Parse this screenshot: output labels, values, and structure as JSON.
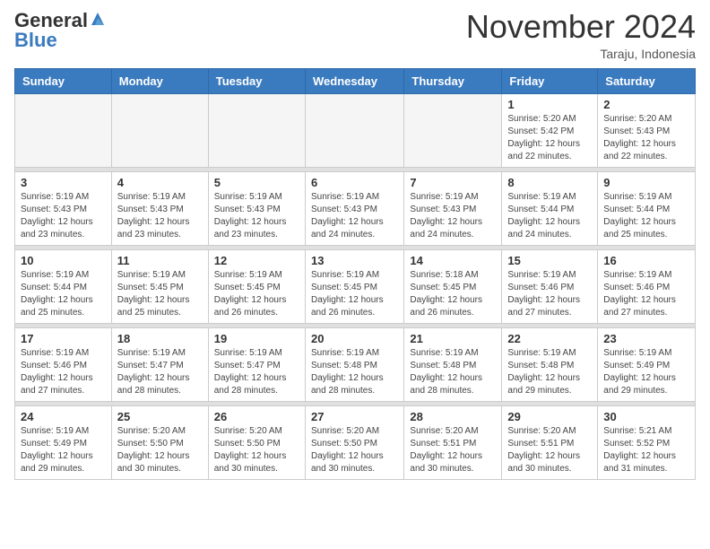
{
  "logo": {
    "general": "General",
    "blue": "Blue"
  },
  "header": {
    "month": "November 2024",
    "location": "Taraju, Indonesia"
  },
  "weekdays": [
    "Sunday",
    "Monday",
    "Tuesday",
    "Wednesday",
    "Thursday",
    "Friday",
    "Saturday"
  ],
  "weeks": [
    [
      {
        "day": "",
        "info": ""
      },
      {
        "day": "",
        "info": ""
      },
      {
        "day": "",
        "info": ""
      },
      {
        "day": "",
        "info": ""
      },
      {
        "day": "",
        "info": ""
      },
      {
        "day": "1",
        "info": "Sunrise: 5:20 AM\nSunset: 5:42 PM\nDaylight: 12 hours\nand 22 minutes."
      },
      {
        "day": "2",
        "info": "Sunrise: 5:20 AM\nSunset: 5:43 PM\nDaylight: 12 hours\nand 22 minutes."
      }
    ],
    [
      {
        "day": "3",
        "info": "Sunrise: 5:19 AM\nSunset: 5:43 PM\nDaylight: 12 hours\nand 23 minutes."
      },
      {
        "day": "4",
        "info": "Sunrise: 5:19 AM\nSunset: 5:43 PM\nDaylight: 12 hours\nand 23 minutes."
      },
      {
        "day": "5",
        "info": "Sunrise: 5:19 AM\nSunset: 5:43 PM\nDaylight: 12 hours\nand 23 minutes."
      },
      {
        "day": "6",
        "info": "Sunrise: 5:19 AM\nSunset: 5:43 PM\nDaylight: 12 hours\nand 24 minutes."
      },
      {
        "day": "7",
        "info": "Sunrise: 5:19 AM\nSunset: 5:43 PM\nDaylight: 12 hours\nand 24 minutes."
      },
      {
        "day": "8",
        "info": "Sunrise: 5:19 AM\nSunset: 5:44 PM\nDaylight: 12 hours\nand 24 minutes."
      },
      {
        "day": "9",
        "info": "Sunrise: 5:19 AM\nSunset: 5:44 PM\nDaylight: 12 hours\nand 25 minutes."
      }
    ],
    [
      {
        "day": "10",
        "info": "Sunrise: 5:19 AM\nSunset: 5:44 PM\nDaylight: 12 hours\nand 25 minutes."
      },
      {
        "day": "11",
        "info": "Sunrise: 5:19 AM\nSunset: 5:45 PM\nDaylight: 12 hours\nand 25 minutes."
      },
      {
        "day": "12",
        "info": "Sunrise: 5:19 AM\nSunset: 5:45 PM\nDaylight: 12 hours\nand 26 minutes."
      },
      {
        "day": "13",
        "info": "Sunrise: 5:19 AM\nSunset: 5:45 PM\nDaylight: 12 hours\nand 26 minutes."
      },
      {
        "day": "14",
        "info": "Sunrise: 5:18 AM\nSunset: 5:45 PM\nDaylight: 12 hours\nand 26 minutes."
      },
      {
        "day": "15",
        "info": "Sunrise: 5:19 AM\nSunset: 5:46 PM\nDaylight: 12 hours\nand 27 minutes."
      },
      {
        "day": "16",
        "info": "Sunrise: 5:19 AM\nSunset: 5:46 PM\nDaylight: 12 hours\nand 27 minutes."
      }
    ],
    [
      {
        "day": "17",
        "info": "Sunrise: 5:19 AM\nSunset: 5:46 PM\nDaylight: 12 hours\nand 27 minutes."
      },
      {
        "day": "18",
        "info": "Sunrise: 5:19 AM\nSunset: 5:47 PM\nDaylight: 12 hours\nand 28 minutes."
      },
      {
        "day": "19",
        "info": "Sunrise: 5:19 AM\nSunset: 5:47 PM\nDaylight: 12 hours\nand 28 minutes."
      },
      {
        "day": "20",
        "info": "Sunrise: 5:19 AM\nSunset: 5:48 PM\nDaylight: 12 hours\nand 28 minutes."
      },
      {
        "day": "21",
        "info": "Sunrise: 5:19 AM\nSunset: 5:48 PM\nDaylight: 12 hours\nand 28 minutes."
      },
      {
        "day": "22",
        "info": "Sunrise: 5:19 AM\nSunset: 5:48 PM\nDaylight: 12 hours\nand 29 minutes."
      },
      {
        "day": "23",
        "info": "Sunrise: 5:19 AM\nSunset: 5:49 PM\nDaylight: 12 hours\nand 29 minutes."
      }
    ],
    [
      {
        "day": "24",
        "info": "Sunrise: 5:19 AM\nSunset: 5:49 PM\nDaylight: 12 hours\nand 29 minutes."
      },
      {
        "day": "25",
        "info": "Sunrise: 5:20 AM\nSunset: 5:50 PM\nDaylight: 12 hours\nand 30 minutes."
      },
      {
        "day": "26",
        "info": "Sunrise: 5:20 AM\nSunset: 5:50 PM\nDaylight: 12 hours\nand 30 minutes."
      },
      {
        "day": "27",
        "info": "Sunrise: 5:20 AM\nSunset: 5:50 PM\nDaylight: 12 hours\nand 30 minutes."
      },
      {
        "day": "28",
        "info": "Sunrise: 5:20 AM\nSunset: 5:51 PM\nDaylight: 12 hours\nand 30 minutes."
      },
      {
        "day": "29",
        "info": "Sunrise: 5:20 AM\nSunset: 5:51 PM\nDaylight: 12 hours\nand 30 minutes."
      },
      {
        "day": "30",
        "info": "Sunrise: 5:21 AM\nSunset: 5:52 PM\nDaylight: 12 hours\nand 31 minutes."
      }
    ]
  ]
}
